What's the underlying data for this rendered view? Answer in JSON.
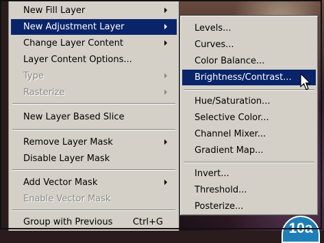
{
  "menu": {
    "items": [
      {
        "label": "New Fill Layer",
        "submenu": true,
        "disabled": false
      },
      {
        "label": "New Adjustment Layer",
        "submenu": true,
        "disabled": false,
        "highlight": true
      },
      {
        "label": "Change Layer Content",
        "submenu": true,
        "disabled": false
      },
      {
        "label": "Layer Content Options...",
        "submenu": false,
        "disabled": false
      },
      {
        "label": "Type",
        "submenu": true,
        "disabled": true
      },
      {
        "label": "Rasterize",
        "submenu": true,
        "disabled": true
      },
      {
        "label": "New Layer Based Slice",
        "submenu": false,
        "disabled": false
      },
      {
        "label": "Remove Layer Mask",
        "submenu": true,
        "disabled": false
      },
      {
        "label": "Disable Layer Mask",
        "submenu": false,
        "disabled": false
      },
      {
        "label": "Add Vector Mask",
        "submenu": true,
        "disabled": false
      },
      {
        "label": "Enable Vector Mask",
        "submenu": false,
        "disabled": true
      },
      {
        "label": "Group with Previous",
        "shortcut": "Ctrl+G",
        "submenu": false,
        "disabled": false
      }
    ]
  },
  "submenu": {
    "items": [
      {
        "label": "Levels..."
      },
      {
        "label": "Curves..."
      },
      {
        "label": "Color Balance..."
      },
      {
        "label": "Brightness/Contrast...",
        "highlight": true
      },
      {
        "label": "Hue/Saturation..."
      },
      {
        "label": "Selective Color..."
      },
      {
        "label": "Channel Mixer..."
      },
      {
        "label": "Gradient Map..."
      },
      {
        "label": "Invert..."
      },
      {
        "label": "Threshold..."
      },
      {
        "label": "Posterize..."
      }
    ]
  },
  "badge": {
    "label": "10a"
  },
  "colors": {
    "highlight": "#0a246a",
    "menu_bg": "#d4d0c8",
    "badge": "#1e7fb8"
  }
}
